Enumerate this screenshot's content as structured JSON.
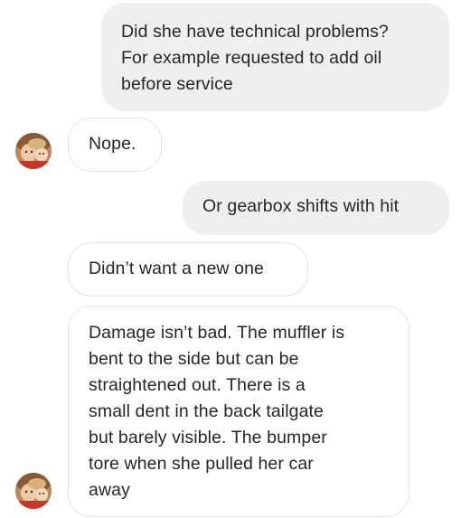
{
  "messages": [
    {
      "id": 1,
      "direction": "sent",
      "text": "Did she have technical problems?\nFor example requested to add oil\nbefore service"
    },
    {
      "id": 2,
      "direction": "received",
      "text": "Nope."
    },
    {
      "id": 3,
      "direction": "sent",
      "text": "Or gearbox shifts with hit"
    },
    {
      "id": 4,
      "direction": "received",
      "text": "Didn’t want a new one"
    },
    {
      "id": 5,
      "direction": "received",
      "text": "Damage isn’t bad.  The muffler is\nbent to the side but can be\nstraightened out.   There is a\nsmall dent in the back tailgate\nbut barely visible.   The bumper\ntore when she pulled her car\naway"
    }
  ],
  "colors": {
    "sent_bubble": "#efefef",
    "received_border": "#e3e3e3",
    "text": "#262626"
  }
}
